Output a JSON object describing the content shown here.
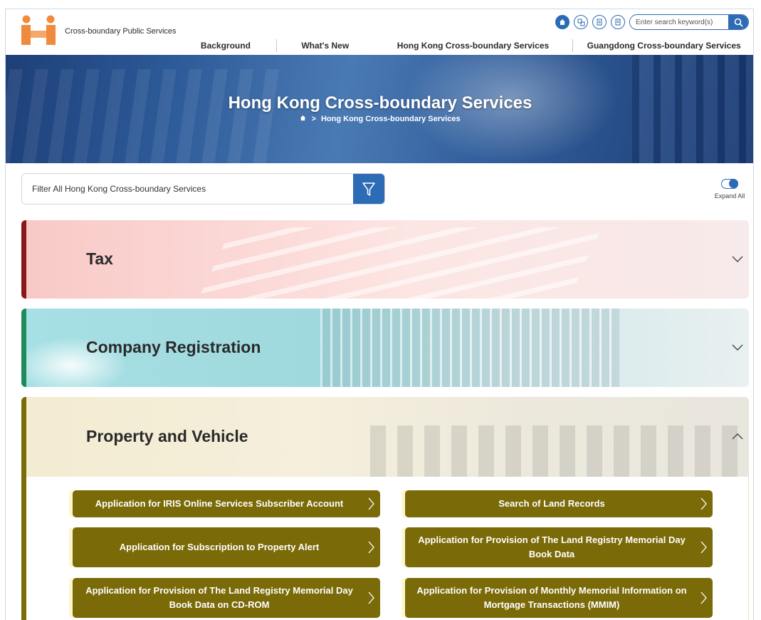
{
  "header": {
    "logo_text": "Cross-boundary Public Services",
    "search_placeholder": "Enter search keyword(s)",
    "top_icons": [
      "home-icon",
      "language-icon",
      "text-size-icon",
      "sitemap-icon"
    ],
    "nav": [
      "Background",
      "What's New",
      "Hong Kong Cross-boundary Services",
      "Guangdong Cross-boundary Services"
    ]
  },
  "banner": {
    "title": "Hong Kong Cross-boundary Services",
    "breadcrumb_sep": ">",
    "breadcrumb_current": "Hong Kong Cross-boundary Services"
  },
  "filter": {
    "placeholder": "Filter All Hong Kong Cross-boundary Services",
    "expand_all": "Expand All"
  },
  "categories": [
    {
      "title": "Tax",
      "accent": "#8b1717",
      "expanded": false
    },
    {
      "title": "Company Registration",
      "accent": "#1f8a5a",
      "expanded": false
    },
    {
      "title": "Property and Vehicle",
      "accent": "#7a6a08",
      "expanded": true
    }
  ],
  "services": [
    "Application for IRIS Online Services Subscriber Account",
    "Search of Land Records",
    "Application for Subscription to Property Alert",
    "Application for Provision of The Land Registry Memorial Day Book Data",
    "Application for Provision of The Land Registry Memorial Day Book Data on CD-ROM",
    "Application for Provision of Monthly Memorial Information on Mortgage Transactions (MMIM)"
  ],
  "colors": {
    "primary_blue": "#2c6bb5",
    "service_button": "#7a6a08",
    "logo_orange": "#f08a3c"
  }
}
